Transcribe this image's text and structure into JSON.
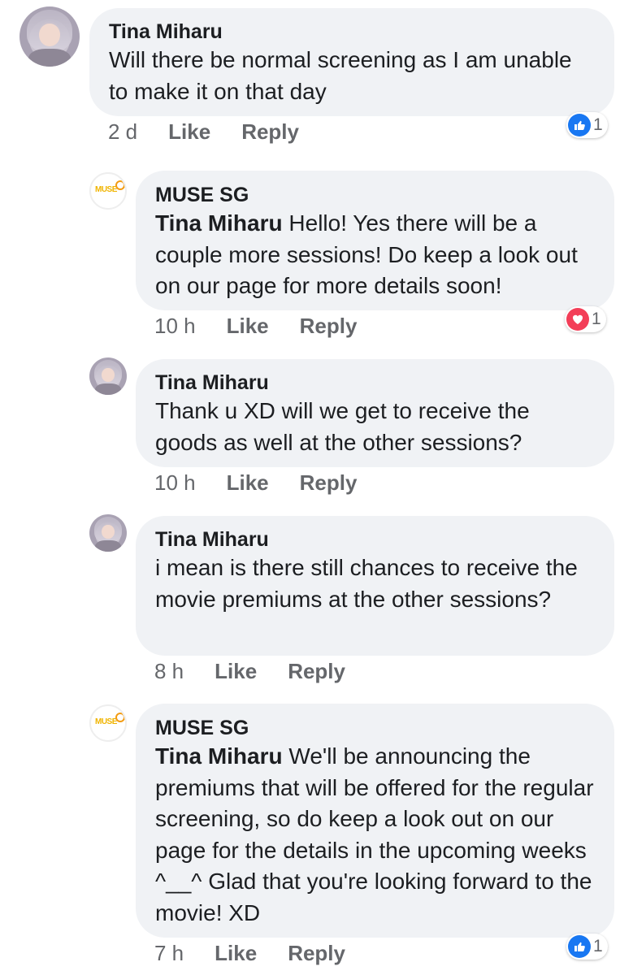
{
  "comments": [
    {
      "author": "Tina Miharu",
      "mention": "",
      "text": "Will there be normal screening as I am unable to make it on that day",
      "time": "2 d",
      "like": "Like",
      "reply": "Reply",
      "reaction": {
        "type": "like",
        "count": "1",
        "icon": "thumbs-up-icon",
        "color": "#1877f2"
      }
    },
    {
      "author": "MUSE SG",
      "mention": "Tina Miharu",
      "text": "Hello! Yes there will be a couple more sessions! Do keep a look out on our page for more details soon!",
      "time": "10 h",
      "like": "Like",
      "reply": "Reply",
      "reaction": {
        "type": "love",
        "count": "1",
        "icon": "heart-icon",
        "color": "#f33e58"
      }
    },
    {
      "author": "Tina Miharu",
      "mention": "",
      "text": "Thank u XD will we get to receive the goods as well at the other sessions?",
      "time": "10 h",
      "like": "Like",
      "reply": "Reply"
    },
    {
      "author": "Tina Miharu",
      "mention": "",
      "text": "i mean is there still chances to receive the movie premiums at the other sessions?",
      "time": "8 h",
      "like": "Like",
      "reply": "Reply"
    },
    {
      "author": "MUSE SG",
      "mention": "Tina Miharu",
      "text": "We'll be announcing the premiums that will be offered for the regular screening, so do keep a look out on our page for the details in the upcoming weeks ^__^ Glad that you're looking forward to the movie! XD",
      "time": "7 h",
      "like": "Like",
      "reply": "Reply",
      "reaction": {
        "type": "like",
        "count": "1",
        "icon": "thumbs-up-icon",
        "color": "#1877f2"
      }
    }
  ],
  "logo_text": "MUSE"
}
